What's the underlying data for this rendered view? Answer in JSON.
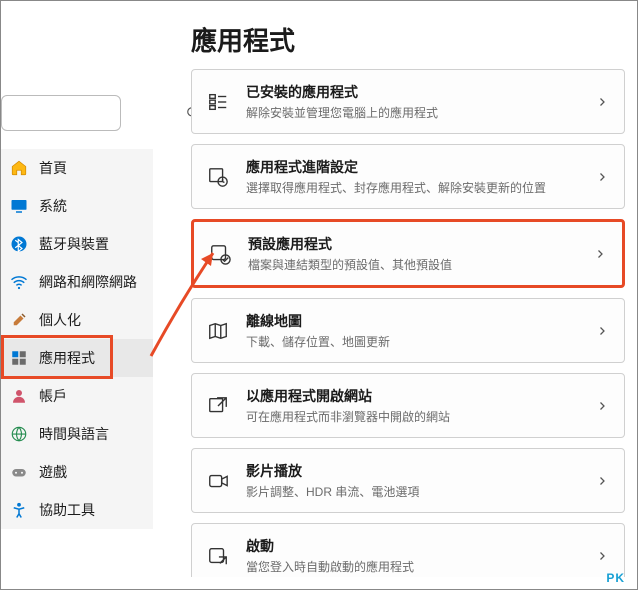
{
  "page_title": "應用程式",
  "search": {
    "placeholder": ""
  },
  "sidebar": {
    "items": [
      {
        "label": "首頁",
        "icon": "home"
      },
      {
        "label": "系統",
        "icon": "system"
      },
      {
        "label": "藍牙與裝置",
        "icon": "bluetooth"
      },
      {
        "label": "網路和網際網路",
        "icon": "wifi"
      },
      {
        "label": "個人化",
        "icon": "brush"
      },
      {
        "label": "應用程式",
        "icon": "apps"
      },
      {
        "label": "帳戶",
        "icon": "account"
      },
      {
        "label": "時間與語言",
        "icon": "globe"
      },
      {
        "label": "遊戲",
        "icon": "game"
      },
      {
        "label": "協助工具",
        "icon": "accessibility"
      }
    ],
    "active_index": 5,
    "highlight_index": 5
  },
  "cards": [
    {
      "title": "已安裝的應用程式",
      "sub": "解除安裝並管理您電腦上的應用程式",
      "icon": "installed"
    },
    {
      "title": "應用程式進階設定",
      "sub": "選擇取得應用程式、封存應用程式、解除安裝更新的位置",
      "icon": "advanced"
    },
    {
      "title": "預設應用程式",
      "sub": "檔案與連結類型的預設值、其他預設值",
      "icon": "default",
      "highlight": true
    },
    {
      "title": "離線地圖",
      "sub": "下載、儲存位置、地圖更新",
      "icon": "map"
    },
    {
      "title": "以應用程式開啟網站",
      "sub": "可在應用程式而非瀏覽器中開啟的網站",
      "icon": "websites"
    },
    {
      "title": "影片播放",
      "sub": "影片調整、HDR 串流、電池選項",
      "icon": "video"
    },
    {
      "title": "啟動",
      "sub": "當您登入時自動啟動的應用程式",
      "icon": "startup"
    }
  ],
  "watermark": "PK",
  "colors": {
    "accent": "#0067c0",
    "annotation": "#e74a26"
  }
}
